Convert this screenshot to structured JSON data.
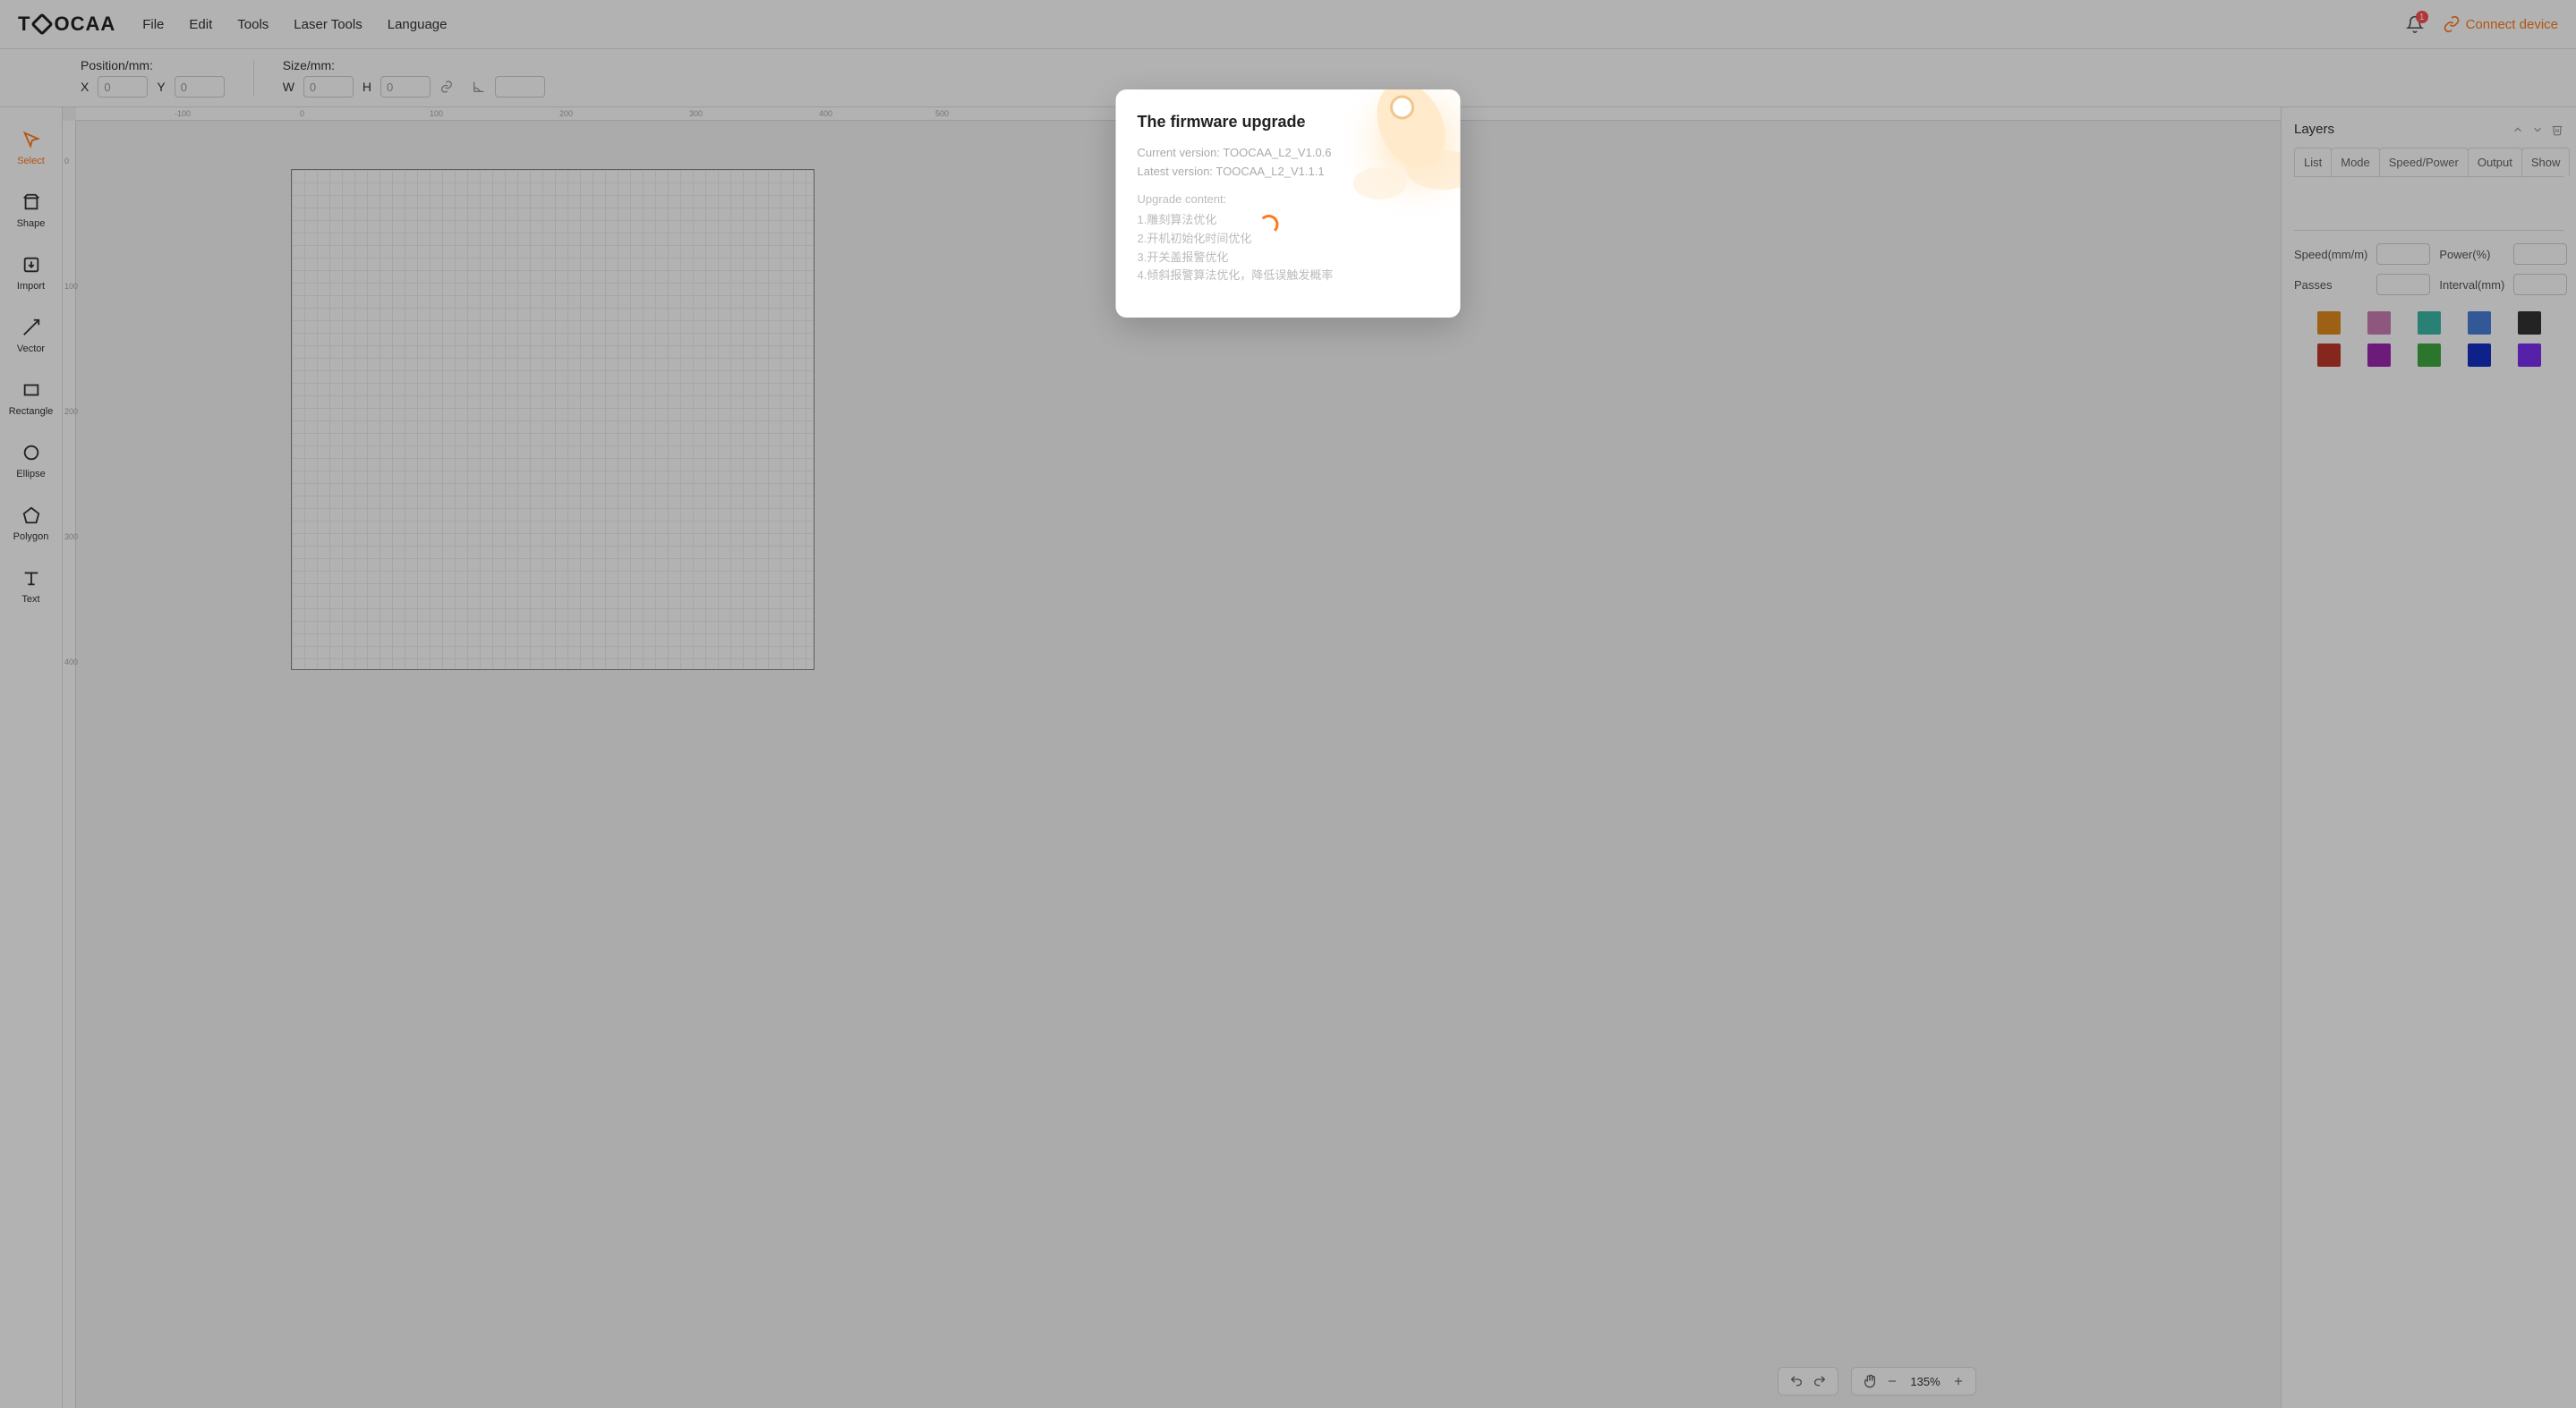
{
  "app": {
    "logo": "TOOCAA"
  },
  "menu": {
    "file": "File",
    "edit": "Edit",
    "tools": "Tools",
    "laser_tools": "Laser Tools",
    "language": "Language"
  },
  "topbar_right": {
    "notif_count": "1",
    "connect": "Connect device"
  },
  "propbar": {
    "position_label": "Position/mm:",
    "size_label": "Size/mm:",
    "x_label": "X",
    "x_val": "0",
    "y_label": "Y",
    "y_val": "0",
    "w_label": "W",
    "w_val": "0",
    "h_label": "H",
    "h_val": "0",
    "rotation_val": ""
  },
  "tools": {
    "select": "Select",
    "shape": "Shape",
    "import": "Import",
    "vector": "Vector",
    "rectangle": "Rectangle",
    "ellipse": "Ellipse",
    "polygon": "Polygon",
    "text": "Text"
  },
  "ruler": {
    "h": [
      "-100",
      "0",
      "100",
      "200",
      "300",
      "400",
      "500"
    ],
    "v": [
      "0",
      "100",
      "200",
      "300",
      "400"
    ]
  },
  "panel": {
    "title": "Layers",
    "tabs": {
      "list": "List",
      "mode": "Mode",
      "speed_power": "Speed/Power",
      "output": "Output",
      "show": "Show"
    },
    "speed_label": "Speed(mm/m)",
    "power_label": "Power(%)",
    "passes_label": "Passes",
    "interval_label": "Interval(mm)",
    "swatches": [
      "#e08b1e",
      "#cc7fb5",
      "#3cb8a8",
      "#4a7ed9",
      "#333333",
      "#c0392b",
      "#9b27b0",
      "#3fa83f",
      "#1430c4",
      "#7b2ff2"
    ]
  },
  "zoom": {
    "value": "135%"
  },
  "modal": {
    "title": "The firmware upgrade",
    "current": "Current version: TOOCAA_L2_V1.0.6",
    "latest": "Latest version: TOOCAA_L2_V1.1.1",
    "content_label": "Upgrade content:",
    "items": [
      "1.雕刻算法优化",
      "2.开机初始化时间优化",
      "3.开关盖报警优化",
      "4.倾斜报警算法优化，降低误触发概率"
    ]
  }
}
